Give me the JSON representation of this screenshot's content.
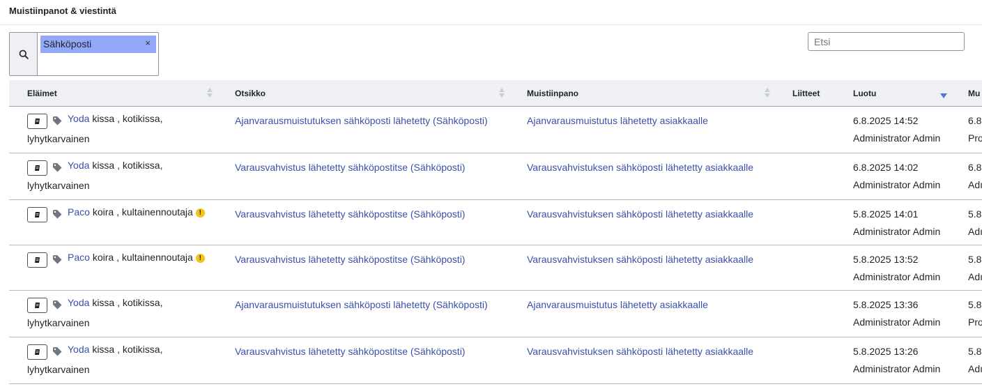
{
  "page": {
    "title": "Muistiinpanot & viestintä"
  },
  "filter": {
    "chip_label": "Sähköposti",
    "chip_remove": "×"
  },
  "search": {
    "placeholder": "Etsi"
  },
  "columns": [
    "Eläimet",
    "Otsikko",
    "Muistiinpano",
    "Liitteet",
    "Luotu",
    "Mu"
  ],
  "rows": [
    {
      "animal_name": "Yoda",
      "species": "kissa",
      "breed_a": ", kotikissa,",
      "breed_b": "lyhytkarvainen",
      "warning": false,
      "title": "Ajanvarausmuistutuksen sähköposti lähetetty (Sähköposti)",
      "note": "Ajanvarausmuistutus lähetetty asiakkaalle",
      "created_date": "6.8.2025 14:52",
      "created_by": "Administrator Admin",
      "mod_date": "6.8",
      "mod_by": "Pro"
    },
    {
      "animal_name": "Yoda",
      "species": "kissa",
      "breed_a": ", kotikissa,",
      "breed_b": "lyhytkarvainen",
      "warning": false,
      "title": "Varausvahvistus lähetetty sähköpostitse (Sähköposti)",
      "note": "Varausvahvistuksen sähköposti lähetetty asiakkaalle",
      "created_date": "6.8.2025 14:02",
      "created_by": "Administrator Admin",
      "mod_date": "6.8",
      "mod_by": "Adı"
    },
    {
      "animal_name": "Paco",
      "species": "koira",
      "breed_a": ", kultainennoutaja",
      "breed_b": "",
      "warning": true,
      "title": "Varausvahvistus lähetetty sähköpostitse (Sähköposti)",
      "note": "Varausvahvistuksen sähköposti lähetetty asiakkaalle",
      "created_date": "5.8.2025 14:01",
      "created_by": "Administrator Admin",
      "mod_date": "5.8",
      "mod_by": "Adı"
    },
    {
      "animal_name": "Paco",
      "species": "koira",
      "breed_a": ", kultainennoutaja",
      "breed_b": "",
      "warning": true,
      "title": "Varausvahvistus lähetetty sähköpostitse (Sähköposti)",
      "note": "Varausvahvistuksen sähköposti lähetetty asiakkaalle",
      "created_date": "5.8.2025 13:52",
      "created_by": "Administrator Admin",
      "mod_date": "5.8",
      "mod_by": "Adı"
    },
    {
      "animal_name": "Yoda",
      "species": "kissa",
      "breed_a": ", kotikissa,",
      "breed_b": "lyhytkarvainen",
      "warning": false,
      "title": "Ajanvarausmuistutuksen sähköposti lähetetty (Sähköposti)",
      "note": "Ajanvarausmuistutus lähetetty asiakkaalle",
      "created_date": "5.8.2025 13:36",
      "created_by": "Administrator Admin",
      "mod_date": "5.8",
      "mod_by": "Pro"
    },
    {
      "animal_name": "Yoda",
      "species": "kissa",
      "breed_a": ", kotikissa,",
      "breed_b": "lyhytkarvainen",
      "warning": false,
      "title": "Varausvahvistus lähetetty sähköpostitse (Sähköposti)",
      "note": "Varausvahvistuksen sähköposti lähetetty asiakkaalle",
      "created_date": "5.8.2025 13:26",
      "created_by": "Administrator Admin",
      "mod_date": "5.8",
      "mod_by": "Adı"
    }
  ],
  "icons": {
    "search": "search-icon",
    "note": "note-icon",
    "tag": "tag-icon",
    "warning": "warning-icon",
    "sort": "sort-icon"
  },
  "colors": {
    "link": "#3b4fa8",
    "chip": "#93a8f8",
    "warning": "#f2c21b",
    "header_bg": "#eef0f3"
  }
}
